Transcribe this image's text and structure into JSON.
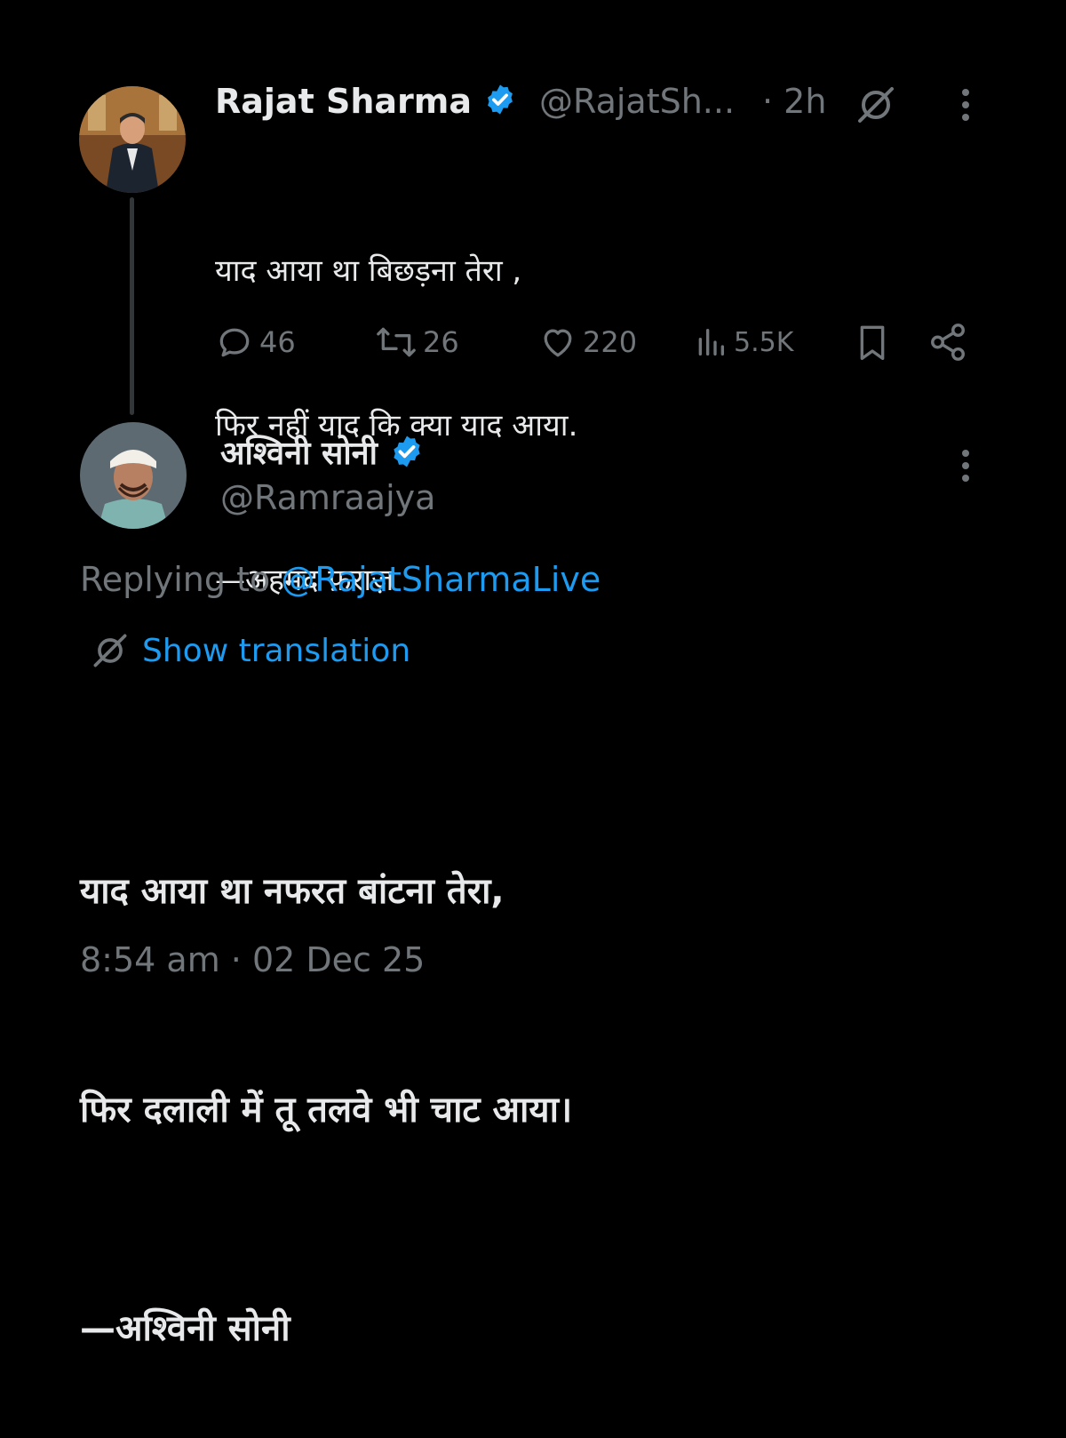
{
  "original_tweet": {
    "author_name": "Rajat Sharma",
    "handle": "@RajatSh...",
    "time": "· 2h",
    "lines": [
      "याद आया था बिछड़ना तेरा ,",
      "फिर नहीं याद कि क्या याद आया.",
      "—अहमद फ़राज़"
    ],
    "actions": {
      "replies": "46",
      "reposts": "26",
      "likes": "220",
      "views": "5.5K"
    },
    "icons": [
      "verified-badge-icon",
      "grok-icon",
      "more-icon",
      "reply-icon",
      "repost-icon",
      "like-icon",
      "views-icon",
      "bookmark-icon",
      "share-icon"
    ]
  },
  "reply_tweet": {
    "author_name": "अश्विनी सोनी",
    "handle": "@Ramraajya",
    "replying_prefix": "Replying to",
    "replying_handle": "@RajatSharmaLive",
    "translation_label": "Show translation",
    "lines": [
      "याद आया था नफरत बांटना तेरा,",
      "फिर दलाली में तू तलवे भी चाट आया।",
      "—अश्विनी सोनी"
    ],
    "timestamp": "8:54 am · 02 Dec 25"
  },
  "colors": {
    "background": "#000000",
    "text": "#e7e9ea",
    "secondary": "#71767b",
    "accent": "#1d9bf0"
  }
}
